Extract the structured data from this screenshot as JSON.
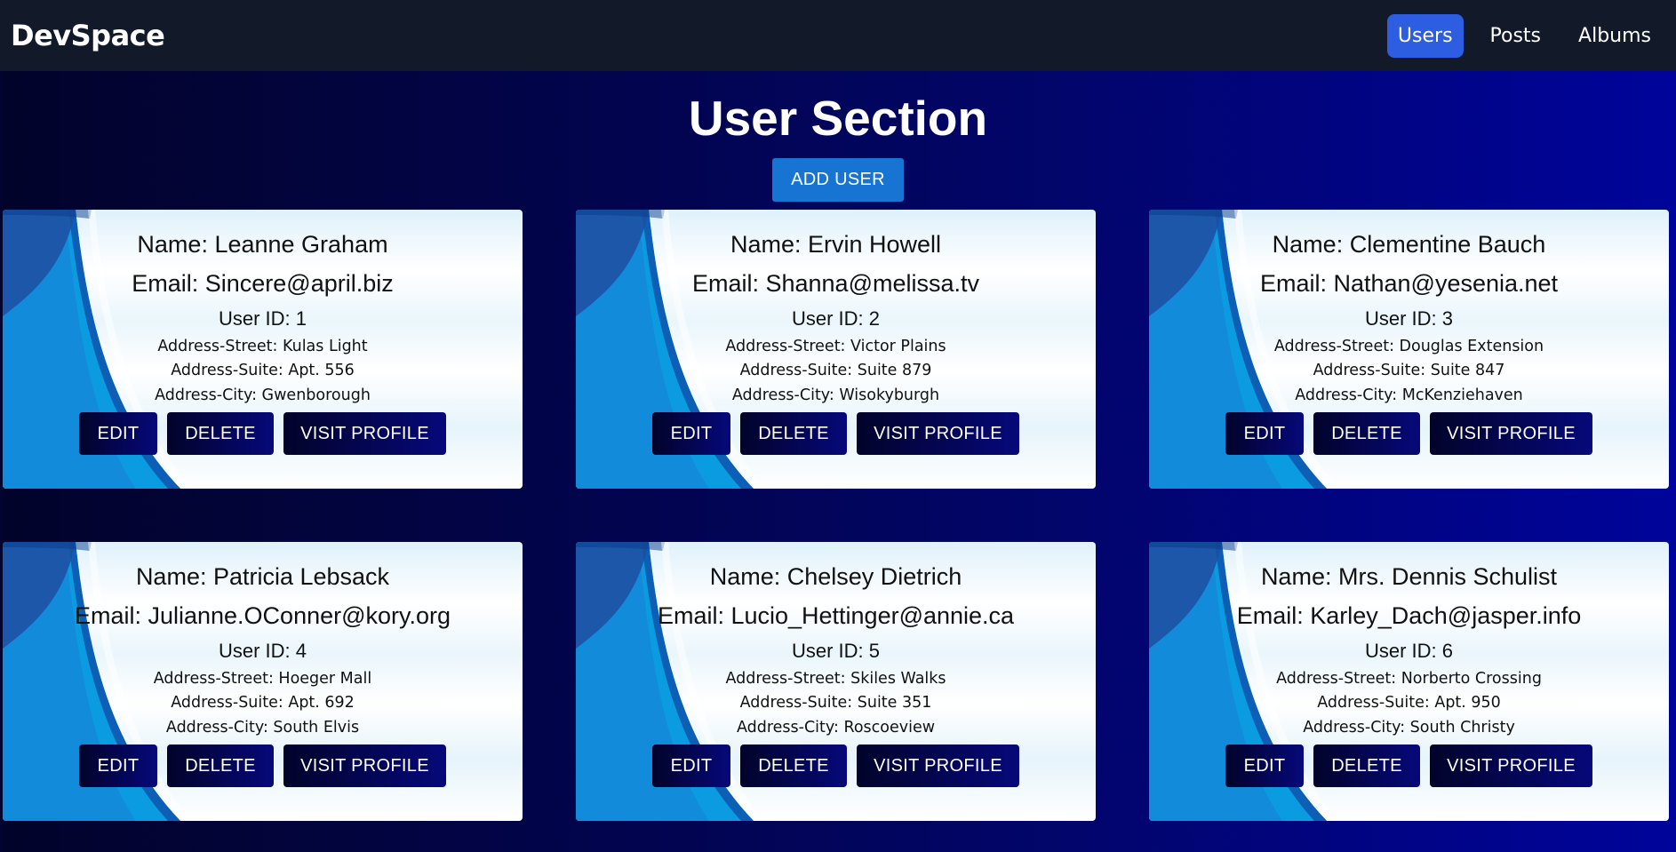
{
  "nav": {
    "brand": "DevSpace",
    "links": [
      {
        "label": "Users",
        "active": true
      },
      {
        "label": "Posts",
        "active": false
      },
      {
        "label": "Albums",
        "active": false
      }
    ]
  },
  "page": {
    "title": "User Section",
    "add_label": "ADD USER"
  },
  "buttons": {
    "edit": "EDIT",
    "delete": "DELETE",
    "visit": "VISIT PROFILE"
  },
  "users": [
    {
      "name": "Name: Leanne Graham",
      "email": "Email: Sincere@april.biz",
      "id": "User ID: 1",
      "street": "Address-Street: Kulas Light",
      "suite": "Address-Suite: Apt. 556",
      "city": "Address-City: Gwenborough"
    },
    {
      "name": "Name: Ervin Howell",
      "email": "Email: Shanna@melissa.tv",
      "id": "User ID: 2",
      "street": "Address-Street: Victor Plains",
      "suite": "Address-Suite: Suite 879",
      "city": "Address-City: Wisokyburgh"
    },
    {
      "name": "Name: Clementine Bauch",
      "email": "Email: Nathan@yesenia.net",
      "id": "User ID: 3",
      "street": "Address-Street: Douglas Extension",
      "suite": "Address-Suite: Suite 847",
      "city": "Address-City: McKenziehaven"
    },
    {
      "name": "Name: Patricia Lebsack",
      "email": "Email: Julianne.OConner@kory.org",
      "id": "User ID: 4",
      "street": "Address-Street: Hoeger Mall",
      "suite": "Address-Suite: Apt. 692",
      "city": "Address-City: South Elvis"
    },
    {
      "name": "Name: Chelsey Dietrich",
      "email": "Email: Lucio_Hettinger@annie.ca",
      "id": "User ID: 5",
      "street": "Address-Street: Skiles Walks",
      "suite": "Address-Suite: Suite 351",
      "city": "Address-City: Roscoeview"
    },
    {
      "name": "Name: Mrs. Dennis Schulist",
      "email": "Email: Karley_Dach@jasper.info",
      "id": "User ID: 6",
      "street": "Address-Street: Norberto Crossing",
      "suite": "Address-Suite: Apt. 950",
      "city": "Address-City: South Christy"
    }
  ]
}
